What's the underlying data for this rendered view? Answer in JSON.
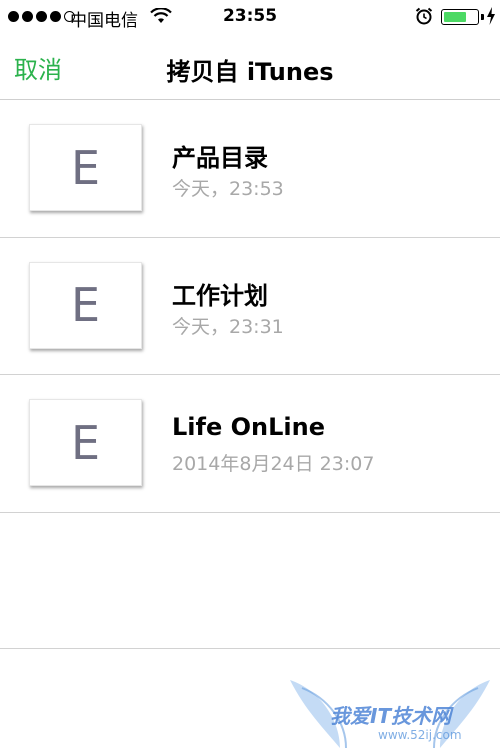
{
  "status_bar": {
    "carrier": "中国电信",
    "time": "23:55",
    "signal_bars_filled": 4,
    "signal_bars_total": 5,
    "battery_level": 0.7,
    "battery_color": "#4cd964",
    "icons": [
      "signal-dots-icon",
      "wifi-icon",
      "alarm-icon",
      "battery-icon",
      "charging-bolt-icon"
    ]
  },
  "nav": {
    "cancel_label": "取消",
    "title": "拷贝自 iTunes",
    "accent_color": "#2bb24c"
  },
  "files": [
    {
      "thumb_letter": "E",
      "name": "产品目录",
      "date": "今天，23:53"
    },
    {
      "thumb_letter": "E",
      "name": "工作计划",
      "date": "今天，23:31"
    },
    {
      "thumb_letter": "E",
      "name": "Life OnLine",
      "date": "2014年8月24日 23:07"
    }
  ],
  "watermark": {
    "text": "我爱IT技术网",
    "sub": "www.52ij.com"
  }
}
